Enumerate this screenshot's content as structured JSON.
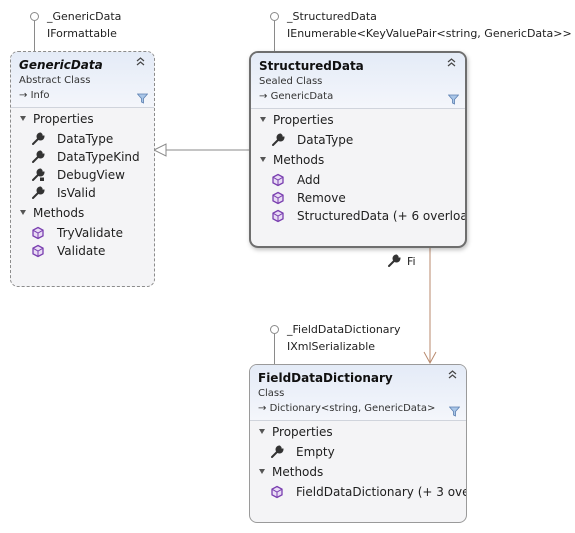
{
  "interfaces": {
    "generic_data": {
      "name": "_GenericData",
      "type": "IFormattable"
    },
    "structured_data": {
      "name": "_StructuredData",
      "type": "IEnumerable<KeyValuePair<string, GenericData>>"
    },
    "field_data_dictionary": {
      "name": "_FieldDataDictionary",
      "type": "IXmlSerializable"
    }
  },
  "classes": {
    "generic_data": {
      "name": "GenericData",
      "kind": "Abstract Class",
      "base": "Info",
      "sections": {
        "properties": {
          "label": "Properties",
          "items": [
            "DataType",
            "DataTypeKind",
            "DebugView",
            "IsValid"
          ]
        },
        "methods": {
          "label": "Methods",
          "items": [
            "TryValidate",
            "Validate"
          ]
        }
      }
    },
    "structured_data": {
      "name": "StructuredData",
      "kind": "Sealed Class",
      "base": "GenericData",
      "sections": {
        "properties": {
          "label": "Properties",
          "items": [
            "DataType"
          ]
        },
        "methods": {
          "label": "Methods",
          "items": [
            "Add",
            "Remove",
            "StructuredData (+ 6 overloa..."
          ]
        }
      }
    },
    "field_data_dictionary": {
      "name": "FieldDataDictionary",
      "kind": "Class",
      "base": "Dictionary<string, GenericData>",
      "sections": {
        "properties": {
          "label": "Properties",
          "items": [
            "Empty"
          ]
        },
        "methods": {
          "label": "Methods",
          "items": [
            "FieldDataDictionary (+ 3 ove..."
          ]
        }
      }
    }
  },
  "association": {
    "label": "Fi"
  },
  "icons": {
    "property": "wrench-icon",
    "method": "cube-icon",
    "inherits": "inherit-arrow-icon",
    "collapse": "double-chevron-up-icon",
    "filter": "filter-icon"
  },
  "colors": {
    "header_gradient_top": "#e4ebf7",
    "body": "#f4f4f6",
    "method_icon": "#7a3fb0",
    "association_line": "#b88a6e"
  }
}
